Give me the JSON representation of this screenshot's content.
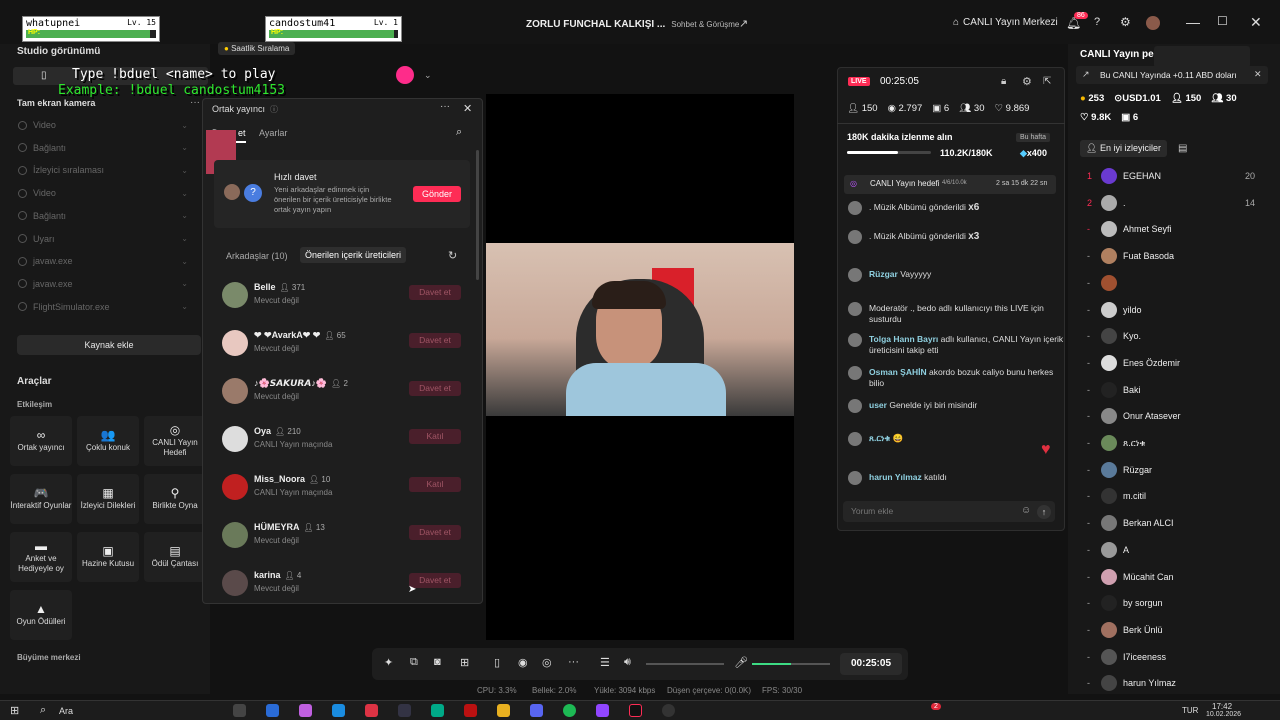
{
  "hp_cards": [
    {
      "name": "whatupnei",
      "level": "Lv. 15",
      "hp": "HP:",
      "fill": 0.95
    },
    {
      "name": "candostum41",
      "level": "Lv. 1",
      "hp": "HP:",
      "fill": 0.97
    }
  ],
  "game_overlay": {
    "line1": "Type !bduel <name> to play",
    "line2": "Example: !bduel candostum4153"
  },
  "window": {
    "title": "ZORLU FUNCHAL KALKIŞI ...",
    "subtitle": "Sohbet & Görüşme",
    "live_center": "CANLI Yayın Merkezi",
    "notif_count": "86",
    "min": "—",
    "max": "☐",
    "close": "✕"
  },
  "left": {
    "studio_view": "Studio görünümü",
    "hourly_rank": "Saatlik Sıralama",
    "fullscreen_camera": "Tam ekran kamera",
    "sources": [
      "Video",
      "Bağlantı",
      "İzleyici sıralaması",
      "Video",
      "Bağlantı",
      "Uyarı",
      "javaw.exe",
      "javaw.exe",
      "FlightSimulator.exe"
    ],
    "add_source": "Kaynak ekle",
    "tools_header": "Araçlar",
    "interaction": "Etkileşim",
    "tools": [
      {
        "icon": "∞",
        "label": "Ortak yayıncı"
      },
      {
        "icon": "👥",
        "label": "Çoklu konuk"
      },
      {
        "icon": "◎",
        "label": "CANLI Yayın Hedefi"
      },
      {
        "icon": "🎮",
        "label": "İnteraktif Oyunlar"
      },
      {
        "icon": "▦",
        "label": "İzleyici Dilekleri"
      },
      {
        "icon": "⚲",
        "label": "Birlikte Oyna"
      },
      {
        "icon": "▬",
        "label": "Anket ve Hediyeyle oy"
      },
      {
        "icon": "▣",
        "label": "Hazine Kutusu"
      },
      {
        "icon": "▤",
        "label": "Ödül Çantası"
      },
      {
        "icon": "▲",
        "label": "Oyun Ödülleri"
      }
    ],
    "growth": "Büyüme merkezi"
  },
  "cohost": {
    "title": "Ortak yayıncı",
    "tab_invite": "Davet et",
    "tab_settings": "Ayarlar",
    "quick_title": "Hızlı davet",
    "quick_desc": "Yeni arkadaşlar edinmek için önerilen bir içerik üreticisiyle birlikte ortak yayın yapın",
    "send": "Gönder",
    "friends_tab": "Arkadaşlar (10)",
    "suggested_tab": "Önerilen içerik üreticileri",
    "people": [
      {
        "name": "Belle",
        "count": "371",
        "status": "Mevcut değil",
        "btn": "Davet et"
      },
      {
        "name": "❤ ❤AvarkA❤ ❤",
        "count": "65",
        "status": "Mevcut değil",
        "btn": "Davet et"
      },
      {
        "name": "♪🌸𝙎𝘼𝙆𝙐𝙍𝘼♪🌸",
        "count": "2",
        "status": "Mevcut değil",
        "btn": "Davet et"
      },
      {
        "name": "Oya",
        "count": "210",
        "status": "CANLI Yayın maçında",
        "btn": "Katıl"
      },
      {
        "name": "Miss_Noora",
        "count": "10",
        "status": "CANLI Yayın maçında",
        "btn": "Katıl"
      },
      {
        "name": "HÜMEYRA",
        "count": "13",
        "status": "Mevcut değil",
        "btn": "Davet et"
      },
      {
        "name": "karina",
        "count": "4",
        "status": "Mevcut değil",
        "btn": "Davet et"
      }
    ]
  },
  "stream": {
    "live": "LIVE",
    "timer": "00:25:05",
    "viewers": "150",
    "views": "2.797",
    "gifts": "6",
    "users": "30",
    "likes": "9.869",
    "goal_text": "180K dakika izlenme alın",
    "this_week": "Bu hafta",
    "goal_progress": "110.2K/180K",
    "goal_multiplier": "x400",
    "goal_fill": 0.61,
    "live_goal": "CANLI Yayın hedefi",
    "live_goal_count": "4/6/10.0k",
    "live_goal_time": "2 sa 15 dk 22 sn"
  },
  "chat": [
    {
      "user": "",
      "text": ". Müzik Albümü gönderildi",
      "extra": "x6"
    },
    {
      "user": "",
      "text": ". Müzik Albümü gönderildi",
      "extra": "x3"
    },
    {
      "user": "Rüzgar",
      "text": "Vayyyyy",
      "extra": ""
    },
    {
      "user": "",
      "text": "Moderatör ., bedo adlı kullanıcıyı this LIVE için susturdu",
      "extra": ""
    },
    {
      "user": "Tolga Hann Bayrı",
      "text": "adlı kullanıcı, CANLI Yayın içerik üreticisini takip etti",
      "extra": ""
    },
    {
      "user": "Osman ŞAHİN",
      "text": "akordo bozuk caliyo bunu herkes bilio",
      "extra": ""
    },
    {
      "user": "user",
      "text": "Genelde iyi biri misindir",
      "extra": ""
    },
    {
      "user": "ጸ.ርነቁ",
      "text": "😄",
      "extra": ""
    },
    {
      "user": "harun Yılmaz",
      "text": "katıldı",
      "extra": ""
    }
  ],
  "chat_placeholder": "Yorum ekle",
  "right": {
    "header": "CANLI Yayın pe",
    "banner": "Bu CANLI Yayında +0.11 ABD doları",
    "coins": "253",
    "usd": "USD1.01",
    "viewers": "150",
    "members": "30",
    "likes": "9.8K",
    "gifts": "6",
    "top_viewers": "En iyi izleyiciler",
    "ranks": [
      {
        "rank": "1",
        "name": "EGEHAN",
        "score": "20"
      },
      {
        "rank": "2",
        "name": ".",
        "score": "14"
      },
      {
        "rank": "-",
        "name": "Ahmet Seyfi",
        "score": ""
      },
      {
        "rank": "-",
        "name": "Fuat Basoda",
        "score": ""
      },
      {
        "rank": "-",
        "name": "",
        "score": ""
      },
      {
        "rank": "-",
        "name": "yildo",
        "score": ""
      },
      {
        "rank": "-",
        "name": "Kyo.",
        "score": ""
      },
      {
        "rank": "-",
        "name": "Enes Özdemir",
        "score": ""
      },
      {
        "rank": "-",
        "name": "Baki",
        "score": ""
      },
      {
        "rank": "-",
        "name": "Onur Atasever",
        "score": ""
      },
      {
        "rank": "-",
        "name": "ጸ.ርነቁ",
        "score": ""
      },
      {
        "rank": "-",
        "name": "Rüzgar",
        "score": ""
      },
      {
        "rank": "-",
        "name": "m.citil",
        "score": ""
      },
      {
        "rank": "-",
        "name": "Berkan ALCI",
        "score": ""
      },
      {
        "rank": "-",
        "name": "A",
        "score": ""
      },
      {
        "rank": "-",
        "name": "Mücahit Can",
        "score": ""
      },
      {
        "rank": "-",
        "name": "by sorgun",
        "score": ""
      },
      {
        "rank": "-",
        "name": "Berk Ünlü",
        "score": ""
      },
      {
        "rank": "-",
        "name": "I7iceeness",
        "score": ""
      },
      {
        "rank": "-",
        "name": "harun Yılmaz",
        "score": ""
      }
    ]
  },
  "controls": {
    "time": "00:25:05"
  },
  "status": {
    "cpu": "CPU: 3.3%",
    "memory": "Bellek: 2.0%",
    "upload": "Yükle: 3094 kbps",
    "dropped": "Düşen çerçeve: 0(0.0K)",
    "fps": "FPS: 30/30"
  },
  "taskbar": {
    "search": "Ara",
    "lang": "TUR",
    "time": "17:42",
    "date": "10.02.2026",
    "badge": "2"
  },
  "colors": {
    "accent": "#fe2c55",
    "live": "#fe2c55",
    "goal": "#ffffff",
    "hp": "#4caf50"
  }
}
